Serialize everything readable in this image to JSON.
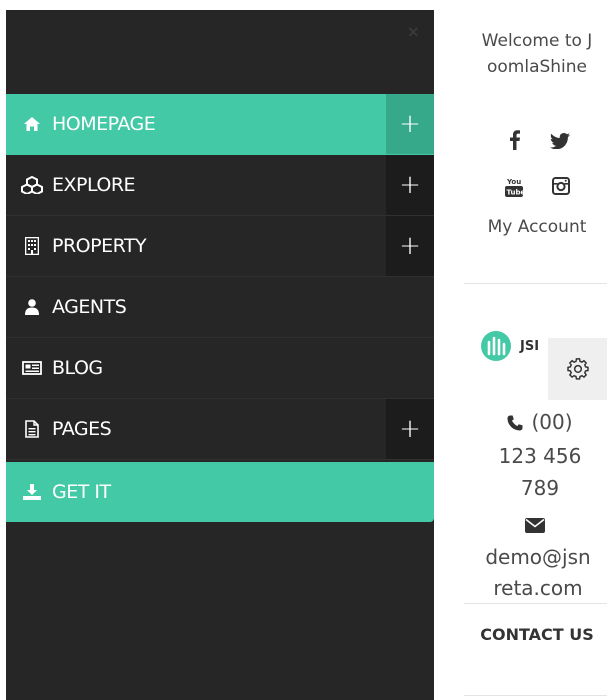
{
  "menu": {
    "close_glyph": "×",
    "items": [
      {
        "label": "HOMEPAGE",
        "icon": "home-icon",
        "has_submenu": true,
        "active": true
      },
      {
        "label": "EXPLORE",
        "icon": "cubes-icon",
        "has_submenu": true,
        "active": false
      },
      {
        "label": "PROPERTY",
        "icon": "building-icon",
        "has_submenu": true,
        "active": false
      },
      {
        "label": "AGENTS",
        "icon": "user-icon",
        "has_submenu": false,
        "active": false
      },
      {
        "label": "BLOG",
        "icon": "newspaper-icon",
        "has_submenu": false,
        "active": false
      },
      {
        "label": "PAGES",
        "icon": "file-icon",
        "has_submenu": true,
        "active": false
      },
      {
        "label": "GET IT",
        "icon": "download-icon",
        "has_submenu": false,
        "active": false
      }
    ],
    "plus_glyph": "+"
  },
  "side": {
    "welcome": "Welcome to JoomlaShine",
    "social_icons": [
      "facebook-icon",
      "twitter-icon",
      "youtube-icon",
      "instagram-icon"
    ],
    "my_account": "My Account",
    "logo_text": "JSI",
    "phone": "(00) 123 456 789",
    "email": "demo@jsnreta.com",
    "contact": "CONTACT US"
  },
  "colors": {
    "accent": "#43c9a6",
    "menu_bg": "#262626",
    "plus_bg": "#1c1c1c"
  }
}
